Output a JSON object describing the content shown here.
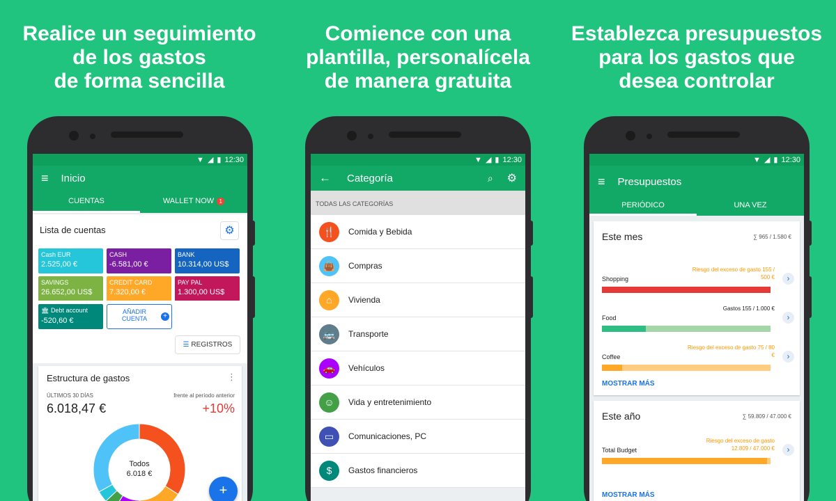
{
  "headlines": [
    "Realice un seguimiento\nde los gastos\nde forma sencilla",
    "Comience con una\nplantilla, personalícela\nde manera gratuita",
    "Establezca presupuestos\npara los gastos que\ndesea controlar"
  ],
  "status_time": "12:30",
  "colors": {
    "background": "#21c47f",
    "appbar": "#12a865",
    "accent_blue": "#1a73e8"
  },
  "phone1": {
    "title": "Inicio",
    "tabs": [
      {
        "label": "CUENTAS"
      },
      {
        "label": "WALLET NOW",
        "badge": "1"
      }
    ],
    "accounts_title": "Lista de cuentas",
    "accounts": [
      {
        "name": "Cash EUR",
        "value": "2.525,00 €",
        "color": "#26c6da"
      },
      {
        "name": "CASH",
        "value": "-6.581,00 €",
        "color": "#7b1fa2"
      },
      {
        "name": "BANK",
        "value": "10.314,00 US$",
        "color": "#1565c0"
      },
      {
        "name": "SAVINGS",
        "value": "26.652,00 US$",
        "color": "#7cb342"
      },
      {
        "name": "CREDIT CARD",
        "value": "7.320,00 €",
        "color": "#ffa726"
      },
      {
        "name": "PAY PAL",
        "value": "1.300,00 US$",
        "color": "#c2185b"
      },
      {
        "name": "Debt account",
        "value": "-520,60 €",
        "color": "#00897b"
      }
    ],
    "add_account": "AÑADIR\nCUENTA",
    "records_button": "REGISTROS",
    "expenses_title": "Estructura de gastos",
    "period_label": "ÚLTIMOS 30 DÍAS",
    "compare_label": "frente al período anterior",
    "total": "6.018,47 €",
    "change": "+10%",
    "donut_label": "Todos",
    "donut_value": "6.018 €",
    "fab": "+"
  },
  "phone2": {
    "title": "Categoría",
    "section": "TODAS LAS CATEGORÍAS",
    "categories": [
      {
        "label": "Comida y Bebida",
        "color": "#f4511e",
        "icon": "fork-knife-icon",
        "glyph": "🍴"
      },
      {
        "label": "Compras",
        "color": "#4fc3f7",
        "icon": "shopping-bag-icon",
        "glyph": "👜"
      },
      {
        "label": "Vivienda",
        "color": "#ffa726",
        "icon": "house-icon",
        "glyph": "⌂"
      },
      {
        "label": "Transporte",
        "color": "#607d8b",
        "icon": "bus-icon",
        "glyph": "🚌"
      },
      {
        "label": "Vehículos",
        "color": "#aa00ff",
        "icon": "car-icon",
        "glyph": "🚗"
      },
      {
        "label": "Vida y entretenimiento",
        "color": "#43a047",
        "icon": "person-icon",
        "glyph": "☺"
      },
      {
        "label": "Comunicaciones, PC",
        "color": "#3f51b5",
        "icon": "monitor-icon",
        "glyph": "▭"
      },
      {
        "label": "Gastos financieros",
        "color": "#00897b",
        "icon": "money-icon",
        "glyph": "$"
      }
    ]
  },
  "phone3": {
    "title": "Presupuestos",
    "tabs": [
      {
        "label": "PERIÓDICO"
      },
      {
        "label": "UNA VEZ"
      }
    ],
    "month": {
      "title": "Este mes",
      "summary": "∑ 965 / 1.580 €",
      "items": [
        {
          "name": "Shopping",
          "note": "Riesgo del exceso de gasto 155 /\n500 €",
          "progress": 1.0,
          "color": "#e53935",
          "track": "#ef9a9a",
          "warn": true
        },
        {
          "name": "Food",
          "note": "Gastos 155 / 1.000 €",
          "progress": 0.26,
          "color": "#2ebd85",
          "track": "#a5d6a7",
          "warn": false
        },
        {
          "name": "Coffee",
          "note": "Riesgo del exceso de gasto 75 / 80\n€",
          "progress": 0.12,
          "color": "#ffa726",
          "track": "#ffcc80",
          "warn": true
        }
      ],
      "more": "MOSTRAR MÁS"
    },
    "year": {
      "title": "Este año",
      "summary": "∑ 59.809 / 47.000 €",
      "items": [
        {
          "name": "Total Budget",
          "note": "Riesgo del exceso de gasto\n12.809 / 47.000 €",
          "progress": 0.98,
          "color": "#ffa726",
          "track": "#ffcc80",
          "warn": true
        }
      ],
      "more": "MOSTRAR MÁS"
    }
  },
  "donut": [
    {
      "value": 0.34,
      "color": "#f4511e"
    },
    {
      "value": 0.16,
      "color": "#ffa726"
    },
    {
      "value": 0.09,
      "color": "#aa00ff"
    },
    {
      "value": 0.04,
      "color": "#43a047"
    },
    {
      "value": 0.04,
      "color": "#26c6da"
    },
    {
      "value": 0.33,
      "color": "#4fc3f7"
    }
  ]
}
